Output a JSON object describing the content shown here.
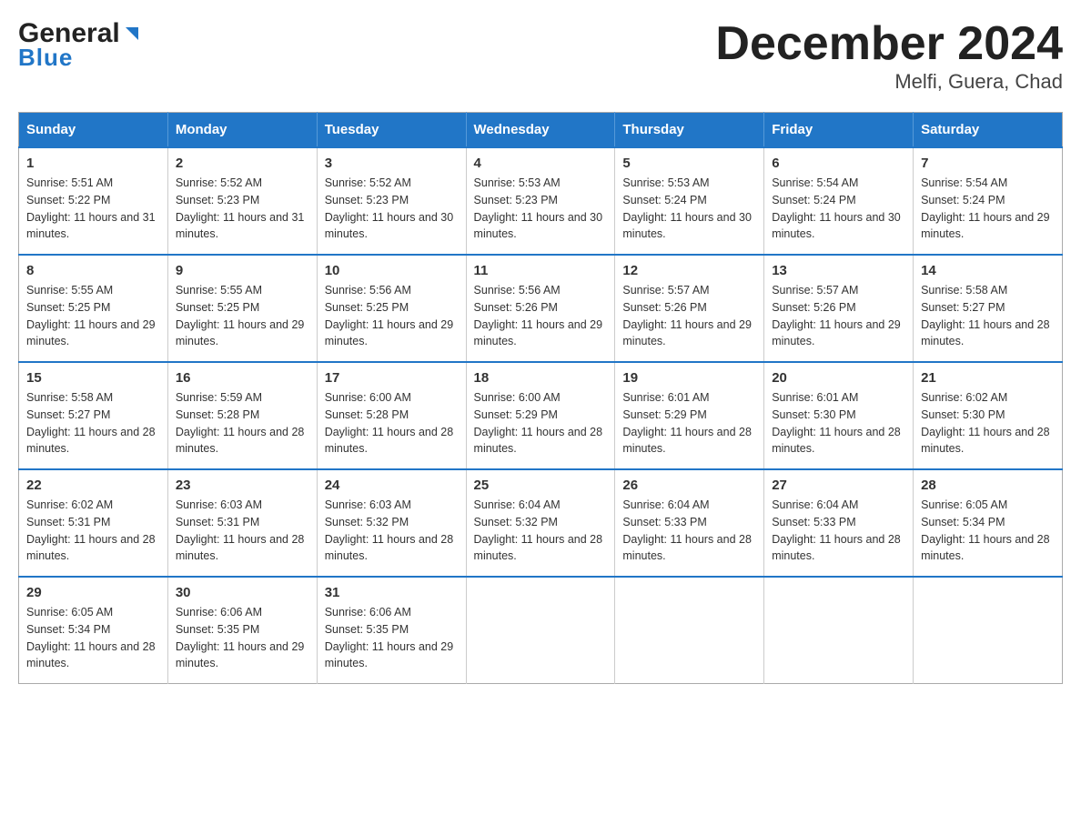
{
  "logo": {
    "name_part1": "General",
    "name_part2": "Blue"
  },
  "title": "December 2024",
  "subtitle": "Melfi, Guera, Chad",
  "days_of_week": [
    "Sunday",
    "Monday",
    "Tuesday",
    "Wednesday",
    "Thursday",
    "Friday",
    "Saturday"
  ],
  "weeks": [
    [
      {
        "day": "1",
        "sunrise": "5:51 AM",
        "sunset": "5:22 PM",
        "daylight": "11 hours and 31 minutes."
      },
      {
        "day": "2",
        "sunrise": "5:52 AM",
        "sunset": "5:23 PM",
        "daylight": "11 hours and 31 minutes."
      },
      {
        "day": "3",
        "sunrise": "5:52 AM",
        "sunset": "5:23 PM",
        "daylight": "11 hours and 30 minutes."
      },
      {
        "day": "4",
        "sunrise": "5:53 AM",
        "sunset": "5:23 PM",
        "daylight": "11 hours and 30 minutes."
      },
      {
        "day": "5",
        "sunrise": "5:53 AM",
        "sunset": "5:24 PM",
        "daylight": "11 hours and 30 minutes."
      },
      {
        "day": "6",
        "sunrise": "5:54 AM",
        "sunset": "5:24 PM",
        "daylight": "11 hours and 30 minutes."
      },
      {
        "day": "7",
        "sunrise": "5:54 AM",
        "sunset": "5:24 PM",
        "daylight": "11 hours and 29 minutes."
      }
    ],
    [
      {
        "day": "8",
        "sunrise": "5:55 AM",
        "sunset": "5:25 PM",
        "daylight": "11 hours and 29 minutes."
      },
      {
        "day": "9",
        "sunrise": "5:55 AM",
        "sunset": "5:25 PM",
        "daylight": "11 hours and 29 minutes."
      },
      {
        "day": "10",
        "sunrise": "5:56 AM",
        "sunset": "5:25 PM",
        "daylight": "11 hours and 29 minutes."
      },
      {
        "day": "11",
        "sunrise": "5:56 AM",
        "sunset": "5:26 PM",
        "daylight": "11 hours and 29 minutes."
      },
      {
        "day": "12",
        "sunrise": "5:57 AM",
        "sunset": "5:26 PM",
        "daylight": "11 hours and 29 minutes."
      },
      {
        "day": "13",
        "sunrise": "5:57 AM",
        "sunset": "5:26 PM",
        "daylight": "11 hours and 29 minutes."
      },
      {
        "day": "14",
        "sunrise": "5:58 AM",
        "sunset": "5:27 PM",
        "daylight": "11 hours and 28 minutes."
      }
    ],
    [
      {
        "day": "15",
        "sunrise": "5:58 AM",
        "sunset": "5:27 PM",
        "daylight": "11 hours and 28 minutes."
      },
      {
        "day": "16",
        "sunrise": "5:59 AM",
        "sunset": "5:28 PM",
        "daylight": "11 hours and 28 minutes."
      },
      {
        "day": "17",
        "sunrise": "6:00 AM",
        "sunset": "5:28 PM",
        "daylight": "11 hours and 28 minutes."
      },
      {
        "day": "18",
        "sunrise": "6:00 AM",
        "sunset": "5:29 PM",
        "daylight": "11 hours and 28 minutes."
      },
      {
        "day": "19",
        "sunrise": "6:01 AM",
        "sunset": "5:29 PM",
        "daylight": "11 hours and 28 minutes."
      },
      {
        "day": "20",
        "sunrise": "6:01 AM",
        "sunset": "5:30 PM",
        "daylight": "11 hours and 28 minutes."
      },
      {
        "day": "21",
        "sunrise": "6:02 AM",
        "sunset": "5:30 PM",
        "daylight": "11 hours and 28 minutes."
      }
    ],
    [
      {
        "day": "22",
        "sunrise": "6:02 AM",
        "sunset": "5:31 PM",
        "daylight": "11 hours and 28 minutes."
      },
      {
        "day": "23",
        "sunrise": "6:03 AM",
        "sunset": "5:31 PM",
        "daylight": "11 hours and 28 minutes."
      },
      {
        "day": "24",
        "sunrise": "6:03 AM",
        "sunset": "5:32 PM",
        "daylight": "11 hours and 28 minutes."
      },
      {
        "day": "25",
        "sunrise": "6:04 AM",
        "sunset": "5:32 PM",
        "daylight": "11 hours and 28 minutes."
      },
      {
        "day": "26",
        "sunrise": "6:04 AM",
        "sunset": "5:33 PM",
        "daylight": "11 hours and 28 minutes."
      },
      {
        "day": "27",
        "sunrise": "6:04 AM",
        "sunset": "5:33 PM",
        "daylight": "11 hours and 28 minutes."
      },
      {
        "day": "28",
        "sunrise": "6:05 AM",
        "sunset": "5:34 PM",
        "daylight": "11 hours and 28 minutes."
      }
    ],
    [
      {
        "day": "29",
        "sunrise": "6:05 AM",
        "sunset": "5:34 PM",
        "daylight": "11 hours and 28 minutes."
      },
      {
        "day": "30",
        "sunrise": "6:06 AM",
        "sunset": "5:35 PM",
        "daylight": "11 hours and 29 minutes."
      },
      {
        "day": "31",
        "sunrise": "6:06 AM",
        "sunset": "5:35 PM",
        "daylight": "11 hours and 29 minutes."
      },
      null,
      null,
      null,
      null
    ]
  ]
}
